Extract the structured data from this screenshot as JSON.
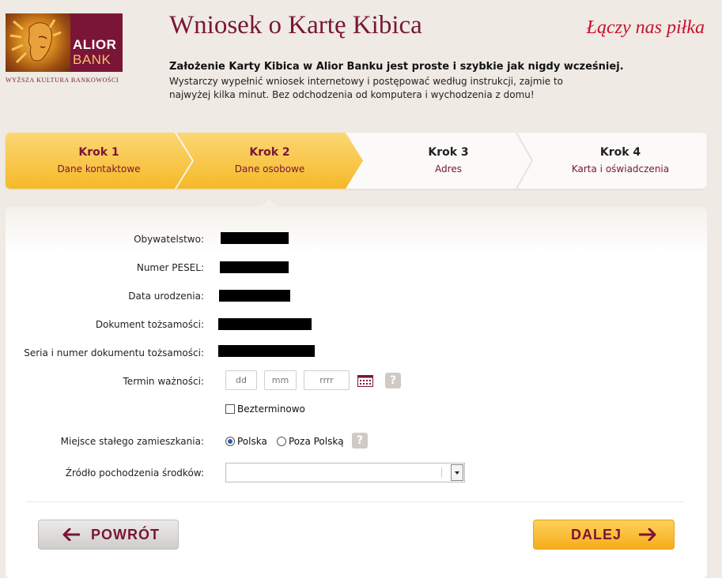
{
  "header": {
    "logo_line1": "ALIOR",
    "logo_line2": "BANK",
    "logo_tagline": "WYŻSZA KULTURA BANKOWOŚCI",
    "title": "Wniosek o Kartę Kibica",
    "slogan": "Łączy nas piłka",
    "intro_bold": "Założenie Karty Kibica w Alior Banku jest proste i szybkie jak nigdy wcześniej.",
    "intro_text": "Wystarczy wypełnić wniosek internetowy i postępować według instrukcji, zajmie to najwyżej kilka minut. Bez odchodzenia od komputera i wychodzenia z domu!"
  },
  "steps": [
    {
      "label": "Krok 1",
      "sub": "Dane kontaktowe",
      "state": "done"
    },
    {
      "label": "Krok 2",
      "sub": "Dane osobowe",
      "state": "active"
    },
    {
      "label": "Krok 3",
      "sub": "Adres",
      "state": "inactive"
    },
    {
      "label": "Krok 4",
      "sub": "Karta i oświadczenia",
      "state": "inactive"
    }
  ],
  "form": {
    "citizenship_label": "Obywatelstwo:",
    "pesel_label": "Numer PESEL:",
    "birth_label": "Data urodzenia:",
    "document_label": "Dokument tożsamości:",
    "doc_number_label": "Seria i numer dokumentu tożsamości:",
    "expiry_label": "Termin ważności:",
    "expiry_day_placeholder": "dd",
    "expiry_month_placeholder": "mm",
    "expiry_year_placeholder": "rrrr",
    "indefinite_label": "Bezterminowo",
    "residence_label": "Miejsce stałego zamieszkania:",
    "residence_options": [
      "Polska",
      "Poza Polską"
    ],
    "residence_selected": "Polska",
    "funds_label": "Źródło pochodzenia środków:",
    "funds_value": "",
    "help_symbol": "?"
  },
  "buttons": {
    "back": "POWRÓT",
    "next": "DALEJ"
  },
  "colors": {
    "brand": "#7a1537",
    "accent": "#f5b928",
    "slogan": "#c8102e"
  }
}
